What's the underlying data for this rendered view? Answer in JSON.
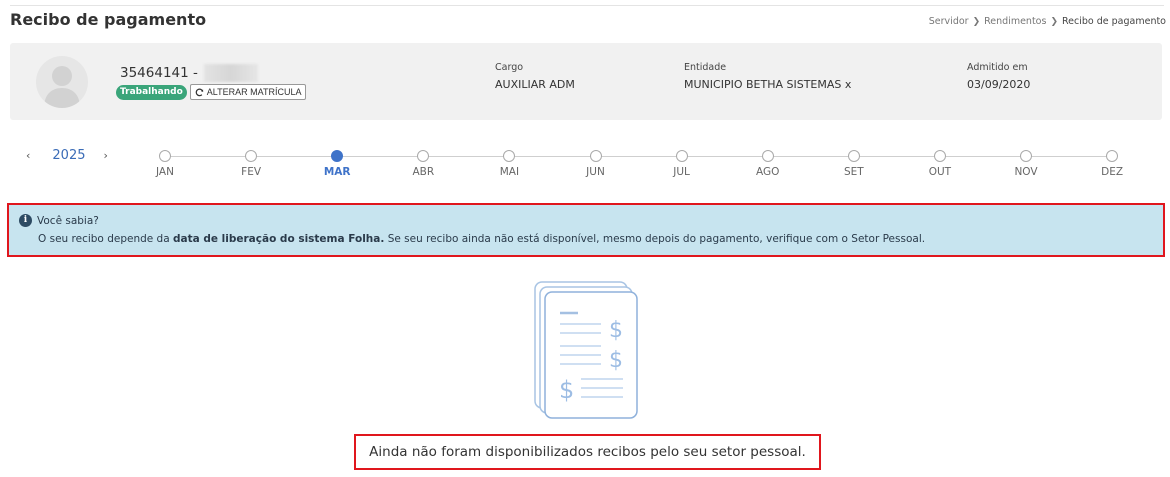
{
  "page": {
    "title": "Recibo de pagamento"
  },
  "breadcrumb": {
    "items": [
      "Servidor",
      "Rendimentos",
      "Recibo de pagamento"
    ]
  },
  "profile": {
    "matricula": "35464141 -",
    "status": "Trabalhando",
    "alter_button": "ALTERAR MATRÍCULA",
    "cargo_label": "Cargo",
    "cargo_value": "AUXILIAR ADM",
    "entidade_label": "Entidade",
    "entidade_value": "MUNICIPIO BETHA SISTEMAS x",
    "admitido_label": "Admitido em",
    "admitido_value": "03/09/2020"
  },
  "year_nav": {
    "prev": "‹",
    "year": "2025",
    "next": "›"
  },
  "months": [
    {
      "label": "JAN",
      "active": false
    },
    {
      "label": "FEV",
      "active": false
    },
    {
      "label": "MAR",
      "active": true
    },
    {
      "label": "ABR",
      "active": false
    },
    {
      "label": "MAI",
      "active": false
    },
    {
      "label": "JUN",
      "active": false
    },
    {
      "label": "JUL",
      "active": false
    },
    {
      "label": "AGO",
      "active": false
    },
    {
      "label": "SET",
      "active": false
    },
    {
      "label": "OUT",
      "active": false
    },
    {
      "label": "NOV",
      "active": false
    },
    {
      "label": "DEZ",
      "active": false
    }
  ],
  "tip": {
    "icon": "i",
    "title": "Você sabia?",
    "text_before": "O seu recibo depende da ",
    "text_bold": "data de liberação do sistema Folha.",
    "text_after": " Se seu recibo ainda não está disponível, mesmo depois do pagamento, verifique com o Setor Pessoal."
  },
  "empty_state": {
    "message": "Ainda não foram disponibilizados recibos pelo seu setor pessoal."
  },
  "colors": {
    "accent": "#3f73c9",
    "status_green": "#3aa57a",
    "tip_bg": "#c7e4ef",
    "highlight_border": "#e0161d"
  }
}
